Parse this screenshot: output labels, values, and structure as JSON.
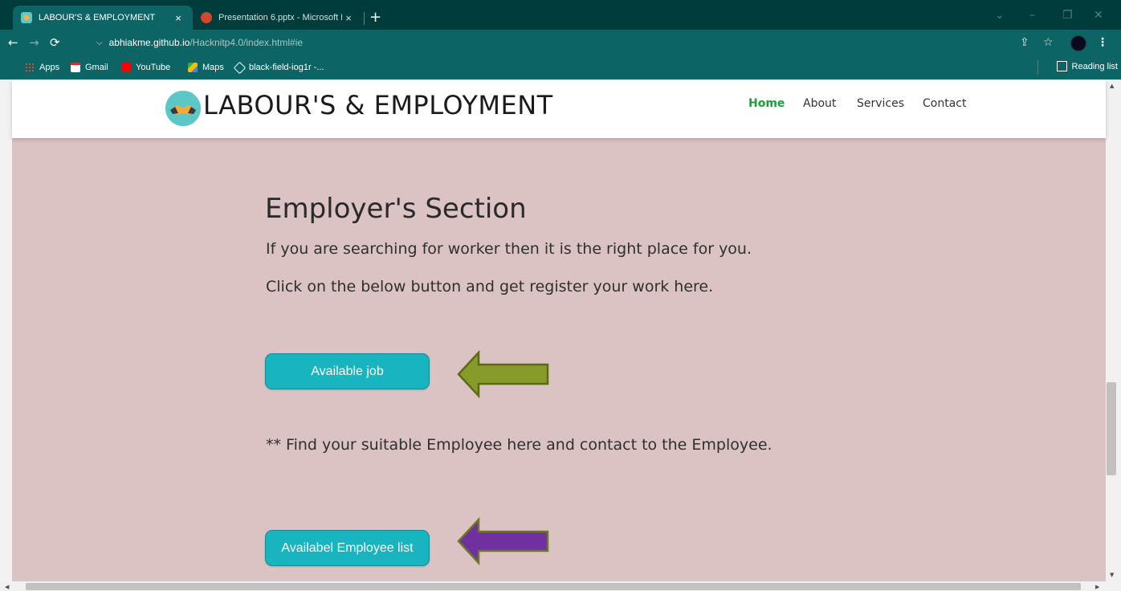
{
  "browser": {
    "tabs": [
      {
        "title": "LABOUR'S & EMPLOYMENT",
        "active": true,
        "favicon": "handshake-icon"
      },
      {
        "title": "Presentation 6.pptx - Microsoft P",
        "active": false,
        "favicon": "powerpoint-icon"
      }
    ],
    "new_tab": "+",
    "close_glyph": "×",
    "url_host": "abhiakme.github.io",
    "url_path": "/Hacknitp4.0/index.html#ie",
    "bookmarks": [
      {
        "label": "Apps",
        "icon": "apps-grid-icon"
      },
      {
        "label": "Gmail",
        "icon": "gmail-icon"
      },
      {
        "label": "YouTube",
        "icon": "youtube-icon"
      },
      {
        "label": "Maps",
        "icon": "maps-icon"
      },
      {
        "label": "black-field-iog1r -...",
        "icon": "codesandbox-icon"
      }
    ],
    "reading_list": "Reading list"
  },
  "site": {
    "logo_text": "LABOUR'S & EMPLOYMENT",
    "nav": [
      "Home",
      "About",
      "Services",
      "Contact"
    ],
    "active_nav": "Home"
  },
  "section": {
    "title": "Employer's Section",
    "line1": "If you are searching for worker then it is the right place for you.",
    "line2": "Click on the below button and get register your work here.",
    "button1": "Available job",
    "note": "** Find your suitable Employee here and contact to the Employee.",
    "button2": "Availabel Employee list"
  },
  "colors": {
    "browser_frame": "#003c3c",
    "toolbar": "#0d6464",
    "page_background": "#dbc3c3",
    "button": "#18b5c0",
    "nav_active": "#1f9d3b",
    "arrow_green": "#879b2a",
    "arrow_purple": "#7030a0"
  }
}
